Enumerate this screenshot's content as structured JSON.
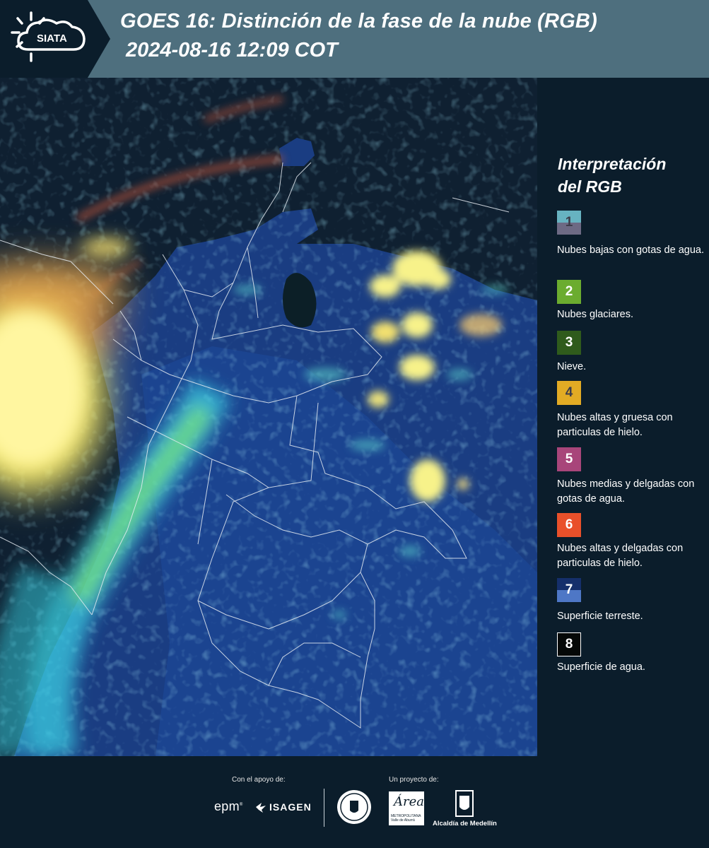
{
  "header": {
    "logo_text": "SIATA",
    "title_line1": "GOES 16: Distinción de la fase de la nube (RGB)",
    "title_line2": "2024-08-16 12:09 COT"
  },
  "legend": {
    "title_line1": "Interpretación",
    "title_line2": "del RGB",
    "items": [
      {
        "number": "1",
        "description": "Nubes bajas con gotas de agua.",
        "color_top": "#67b3c1",
        "color_bottom": "#6d6a84",
        "text_color": "#3d3d4a"
      },
      {
        "number": "2",
        "description": "Nubes glaciares.",
        "color_top": "#6bac2f",
        "text_color": "#ffffff"
      },
      {
        "number": "3",
        "description": "Nieve.",
        "color_top": "#2f5b1c",
        "text_color": "#ffffff"
      },
      {
        "number": "4",
        "description": "Nubes altas y gruesa con particulas de hielo.",
        "color_top": "#e2ab24",
        "text_color": "#3d3d4a"
      },
      {
        "number": "5",
        "description": "Nubes medias y delgadas con gotas de agua.",
        "color_top": "#a8457a",
        "text_color": "#ffffff"
      },
      {
        "number": "6",
        "description": "Nubes altas y delgadas con particulas de hielo.",
        "color_top": "#e9502a",
        "text_color": "#ffffff"
      },
      {
        "number": "7",
        "description": "Superficie terreste.",
        "color_top": "#152f6b",
        "color_bottom": "#4e77c6",
        "text_color": "#ffffff"
      },
      {
        "number": "8",
        "description": "Superficie de agua.",
        "color_top": "#050807",
        "text_color": "#ffffff",
        "border": "#ffffff"
      }
    ]
  },
  "footer": {
    "support_label": "Con el apoyo de:",
    "project_label": "Un proyecto de:",
    "sponsors": [
      "epm",
      "ISAGEN"
    ],
    "partners": [
      "Area Metropolitana Valle de Aburrá",
      "Alcaldía de Medellín"
    ],
    "alcaldia_text": "Alcaldía de Medellín",
    "area_text": "Área",
    "area_subtext": "METROPOLITANA Valle de Aburrá"
  }
}
